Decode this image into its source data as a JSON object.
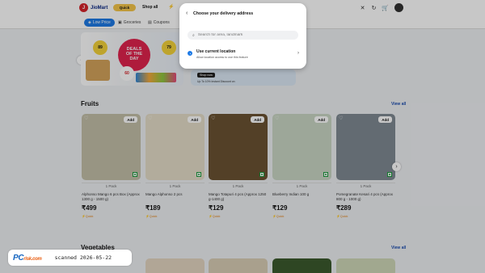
{
  "header": {
    "logo_text": "JioMart",
    "quick_label": "Quick",
    "shop_all_label": "Shop all",
    "icons": [
      "close-icon",
      "history-icon",
      "cart-icon",
      "user-icon"
    ]
  },
  "categories": [
    {
      "label": "Low Price",
      "icon": "tag-icon",
      "active": true
    },
    {
      "label": "Groceries",
      "icon": "basket-icon",
      "active": false
    },
    {
      "label": "Coupons",
      "icon": "coupon-icon",
      "active": false
    }
  ],
  "banner": {
    "deal_line1": "DEALS",
    "deal_line2": "OF THE",
    "deal_line3": "DAY",
    "price_left": "89",
    "price_right": "79",
    "price_bottom": "60",
    "shop_now": "Shop now",
    "offer_text": "Up To 10% Instant Discount on"
  },
  "modal": {
    "title": "Choose your delivery address",
    "search_placeholder": "Search for area, landmark",
    "use_current_location": "Use current location",
    "location_subtext": "Allow location access to use this feature"
  },
  "fruits": {
    "title": "Fruits",
    "view_all": "View all",
    "add_label": "Add",
    "pack_label": "1 Pack",
    "quick_label": "Quick",
    "items": [
      {
        "name": "Alphonso Mango 6 pcs Box (Approx 1300 g - 1500 g)",
        "price": "₹499",
        "color": "#c3bfa8"
      },
      {
        "name": "Mango Alphonso 2 pcs",
        "price": "₹189",
        "color": "#e5ddc8"
      },
      {
        "name": "Mango Totapuri 4 pcs (Approx 1250 g-1400 g)",
        "price": "₹129",
        "color": "#6b5232"
      },
      {
        "name": "Blueberry Indian 100 g",
        "price": "₹129",
        "color": "#c9d6c5"
      },
      {
        "name": "Pomegranate Kesari 4 pcs (Approx 800 g - 1000 g)",
        "price": "₹289",
        "color": "#7f8a93"
      }
    ]
  },
  "vegetables": {
    "title": "Vegetables",
    "view_all": "View all"
  },
  "watermark": {
    "brand": "PC",
    "brand_suffix": "risk.com",
    "stamp": "scanned 2026-05-22"
  }
}
